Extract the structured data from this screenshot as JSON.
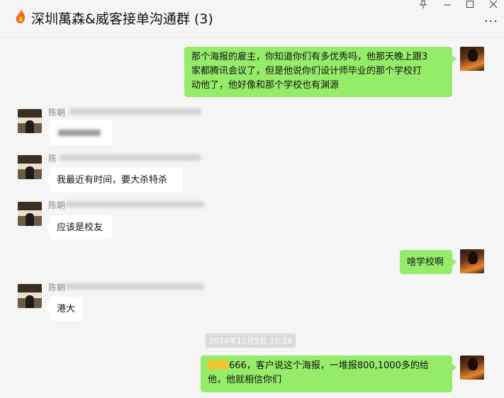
{
  "window": {
    "title": "深圳萬森&威客接单沟通群 (3)",
    "title_emoji_icon": "fire-icon",
    "controls": [
      "pin-icon",
      "minimize-icon",
      "maximize-icon",
      "close-icon"
    ],
    "more_label": "···"
  },
  "messages": [
    {
      "side": "me",
      "lines": [
        "那个海报的雇主，你知道你们有多优秀吗，他那天晚上跟3",
        "家都腾讯会议了，但是他说你们设计师毕业的那个学校打",
        "动他了，他好像和那个学校也有渊源"
      ]
    },
    {
      "side": "them",
      "sender": "陈朝",
      "text": ""
    },
    {
      "side": "them",
      "sender": "陈",
      "text": "我最近有时间，要大杀特杀"
    },
    {
      "side": "them",
      "sender": "陈朝",
      "text": "应该是校友"
    },
    {
      "side": "me",
      "lines": [
        "啥学校啊"
      ]
    },
    {
      "side": "them",
      "sender": "陈朝",
      "text": "港大"
    },
    {
      "side": "me",
      "lines": [
        "666，客户说这个海报，一堆报800,1000多的给",
        "他，他就相信你们"
      ],
      "leading_emojis": [
        "thumbs-up-icon",
        "thumbs-up-icon"
      ]
    }
  ],
  "timestamp": "2024年12月5日 10:28"
}
